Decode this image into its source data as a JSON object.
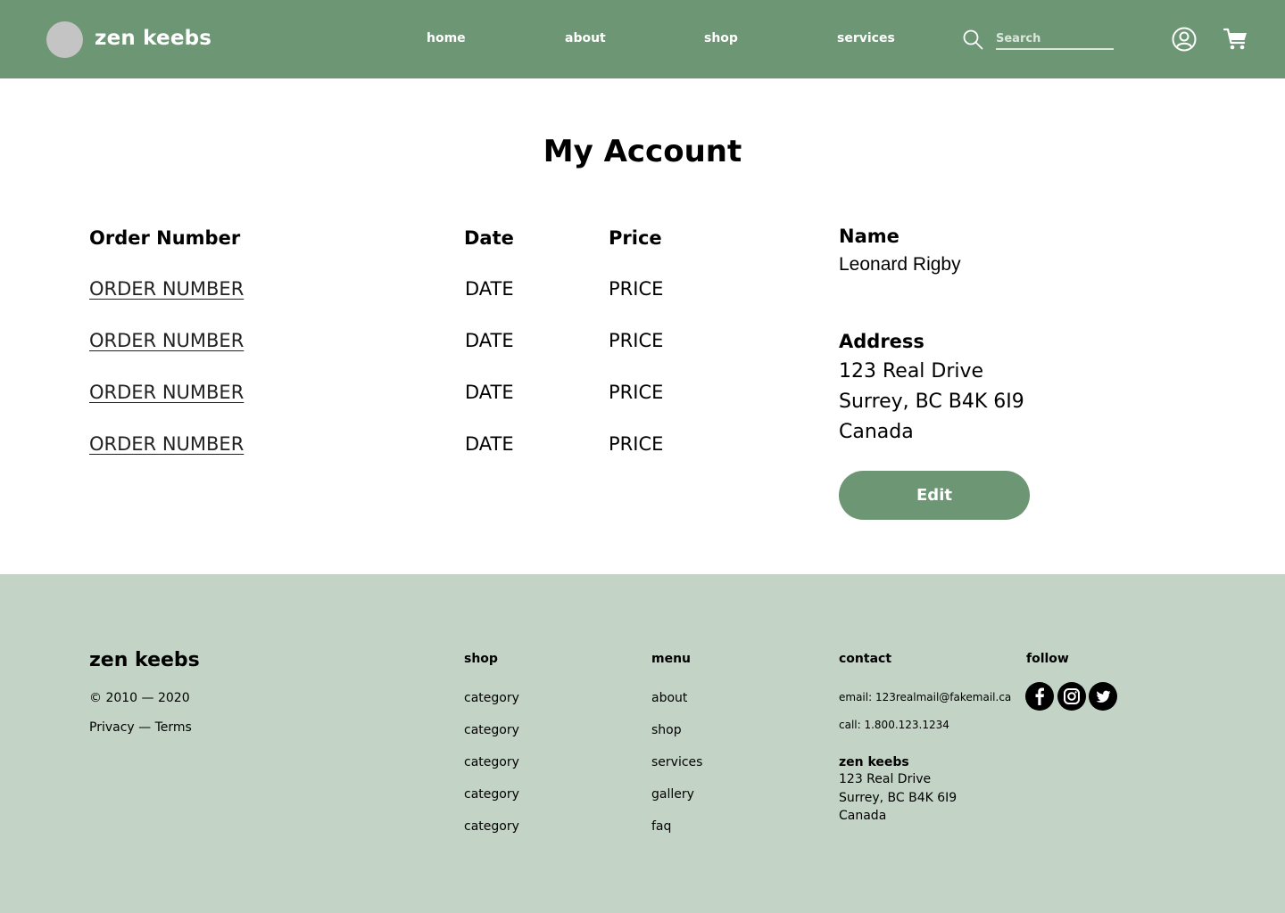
{
  "brand": "zen keebs",
  "nav": [
    "home",
    "about",
    "shop",
    "services"
  ],
  "search": {
    "placeholder": "Search"
  },
  "page_title": "My Account",
  "orders": {
    "headers": {
      "order_number": "Order Number",
      "date": "Date",
      "price": "Price"
    },
    "rows": [
      {
        "order_number": "ORDER NUMBER",
        "date": "DATE",
        "price": "PRICE"
      },
      {
        "order_number": "ORDER NUMBER",
        "date": "DATE",
        "price": "PRICE"
      },
      {
        "order_number": "ORDER NUMBER",
        "date": "DATE",
        "price": "PRICE"
      },
      {
        "order_number": "ORDER NUMBER",
        "date": "DATE",
        "price": "PRICE"
      }
    ]
  },
  "account": {
    "name_label": "Name",
    "name": "Leonard Rigby",
    "address_label": "Address",
    "address_lines": [
      "123 Real Drive",
      "Surrey, BC B4K 6I9",
      "Canada"
    ],
    "edit_label": "Edit"
  },
  "footer": {
    "brand": "zen keebs",
    "copyright": "© 2010 — 2020",
    "privacy": "Privacy",
    "separator": " — ",
    "terms": "Terms",
    "shop_heading": "shop",
    "shop_links": [
      "category",
      "category",
      "category",
      "category",
      "category"
    ],
    "menu_heading": "menu",
    "menu_links": [
      "about",
      "shop",
      "services",
      "gallery",
      "faq"
    ],
    "contact_heading": "contact",
    "email": "email: 123realmail@fakemail.ca",
    "phone": "call: 1.800.123.1234",
    "company": "zen keebs",
    "address_lines": [
      "123 Real Drive",
      "Surrey, BC B4K 6I9",
      "Canada"
    ],
    "follow_heading": "follow",
    "social_icons": [
      "facebook-icon",
      "instagram-icon",
      "twitter-icon"
    ]
  },
  "colors": {
    "primary_green": "#6d9675",
    "footer_green": "#c3d4c7",
    "placeholder_circle": "#c4c4c4"
  }
}
